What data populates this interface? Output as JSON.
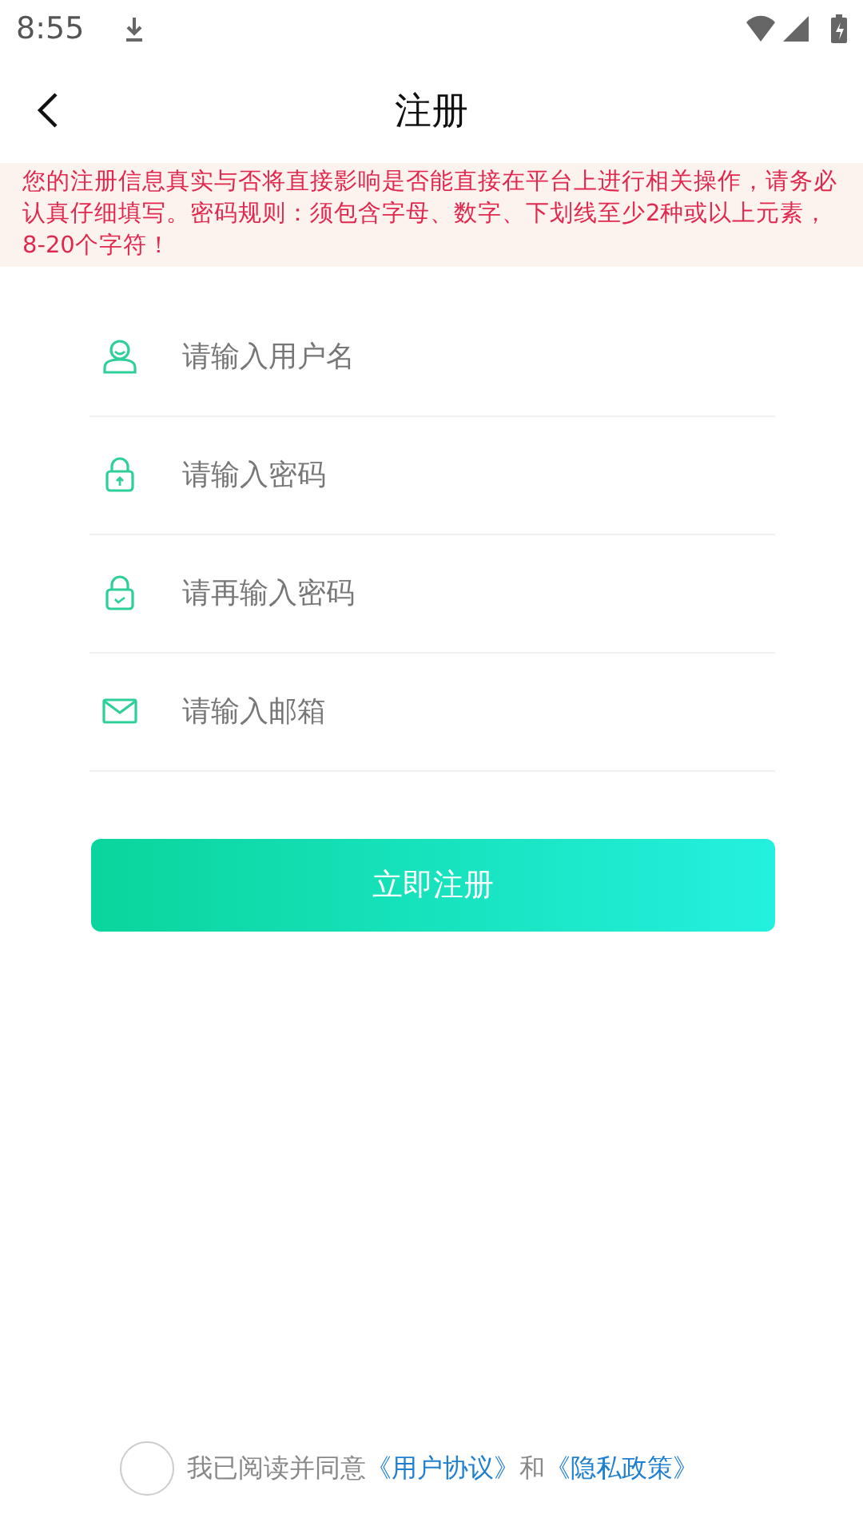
{
  "status_bar": {
    "time": "8:55"
  },
  "header": {
    "title": "注册"
  },
  "notice": "您的注册信息真实与否将直接影响是否能直接在平台上进行相关操作，请务必认真仔细填写。密码规则：须包含字母、数字、下划线至少2种或以上元素，8-20个字符！",
  "fields": [
    {
      "kind": "user",
      "placeholder": "请输入用户名"
    },
    {
      "kind": "lock",
      "placeholder": "请输入密码"
    },
    {
      "kind": "lock-check",
      "placeholder": "请再输入密码"
    },
    {
      "kind": "mail",
      "placeholder": "请输入邮箱"
    }
  ],
  "submit_button": "立即注册",
  "agreement": {
    "checked": false,
    "parts": [
      {
        "kind": "text",
        "text": "我已阅读并同意"
      },
      {
        "kind": "link",
        "text": "《用户协议》"
      },
      {
        "kind": "text",
        "text": "和"
      },
      {
        "kind": "link",
        "text": "《隐私政策》"
      }
    ]
  }
}
